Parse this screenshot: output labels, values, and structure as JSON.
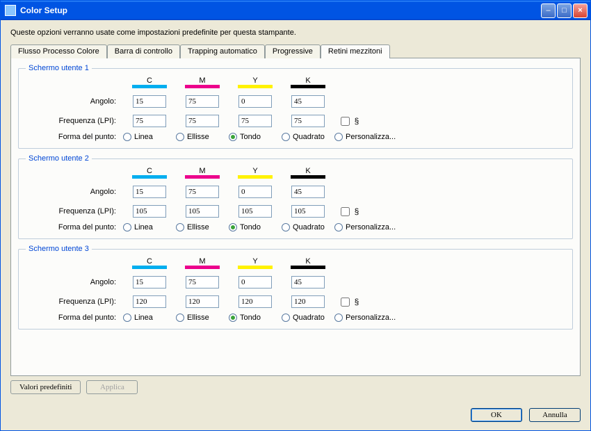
{
  "window": {
    "title": "Color Setup"
  },
  "description": "Queste opzioni verranno usate come impostazioni predefinite per questa stampante.",
  "tabs": [
    {
      "label": "Flusso Processo Colore"
    },
    {
      "label": "Barra di controllo"
    },
    {
      "label": "Trapping automatico"
    },
    {
      "label": "Progressive"
    },
    {
      "label": "Retini mezzitoni"
    }
  ],
  "activeTab": 4,
  "colHeads": {
    "c": "C",
    "m": "M",
    "y": "Y",
    "k": "K"
  },
  "labels": {
    "angle": "Angolo:",
    "freq": "Frequenza (LPI):",
    "dot": "Forma del punto:"
  },
  "dotShapes": {
    "line": "Linea",
    "ellipse": "Ellisse",
    "round": "Tondo",
    "square": "Quadrato",
    "custom": "Personalizza..."
  },
  "screens": [
    {
      "legend": "Schermo utente 1",
      "angle": {
        "c": "15",
        "m": "75",
        "y": "0",
        "k": "45"
      },
      "freq": {
        "c": "75",
        "m": "75",
        "y": "75",
        "k": "75"
      },
      "linked": false,
      "selectedDot": "round"
    },
    {
      "legend": "Schermo utente 2",
      "angle": {
        "c": "15",
        "m": "75",
        "y": "0",
        "k": "45"
      },
      "freq": {
        "c": "105",
        "m": "105",
        "y": "105",
        "k": "105"
      },
      "linked": false,
      "selectedDot": "round"
    },
    {
      "legend": "Schermo utente 3",
      "angle": {
        "c": "15",
        "m": "75",
        "y": "0",
        "k": "45"
      },
      "freq": {
        "c": "120",
        "m": "120",
        "y": "120",
        "k": "120"
      },
      "linked": false,
      "selectedDot": "round"
    }
  ],
  "buttons": {
    "defaults": "Valori predefiniti",
    "apply": "Applica",
    "ok": "OK",
    "cancel": "Annulla"
  }
}
